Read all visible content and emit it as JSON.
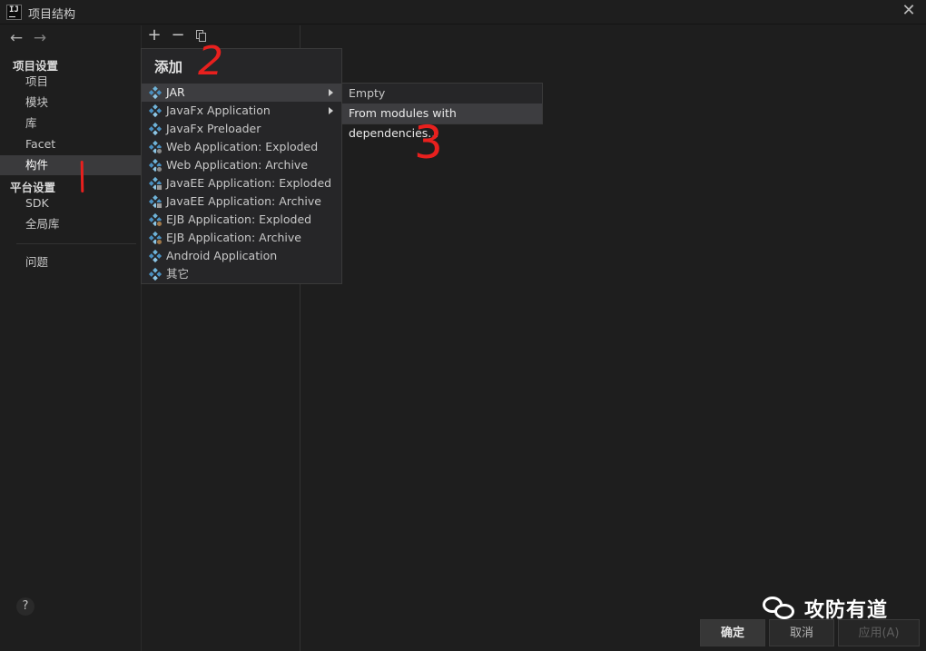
{
  "window": {
    "app_icon_text": "IJ",
    "title": "项目结构",
    "close_glyph": "✕"
  },
  "nav": {
    "back_glyph": "←",
    "forward_glyph": "→"
  },
  "sidebar": {
    "project_settings_header": "项目设置",
    "project_items": [
      {
        "label": "项目"
      },
      {
        "label": "模块"
      },
      {
        "label": "库"
      },
      {
        "label": "Facet"
      },
      {
        "label": "构件",
        "selected": true
      }
    ],
    "platform_settings_header": "平台设置",
    "platform_items": [
      {
        "label": "SDK"
      },
      {
        "label": "全局库"
      }
    ],
    "problems_label": "问题",
    "help_label": "?"
  },
  "toolbar": {
    "add_glyph": "+",
    "remove_glyph": "−",
    "copy_icon": "copy-icon"
  },
  "popup": {
    "title": "添加",
    "items": [
      {
        "label": "JAR",
        "has_submenu": true,
        "active": true
      },
      {
        "label": "JavaFx Application",
        "has_submenu": true
      },
      {
        "label": "JavaFx Preloader"
      },
      {
        "label": "Web Application: Exploded"
      },
      {
        "label": "Web Application: Archive"
      },
      {
        "label": "JavaEE Application: Exploded"
      },
      {
        "label": "JavaEE Application: Archive"
      },
      {
        "label": "EJB Application: Exploded"
      },
      {
        "label": "EJB Application: Archive"
      },
      {
        "label": "Android Application"
      },
      {
        "label": "其它"
      }
    ]
  },
  "submenu": {
    "items": [
      {
        "label": "Empty"
      },
      {
        "label": "From modules with dependencies...",
        "active": true
      }
    ]
  },
  "annotations": {
    "step_2": "2",
    "step_3": "3"
  },
  "watermark": {
    "text": "攻防有道"
  },
  "buttons": {
    "ok": "确定",
    "cancel": "取消",
    "apply": "应用(A)"
  },
  "colors": {
    "background": "#1e1e1e",
    "selection": "#3a3a3c",
    "annotation": "#e8201e",
    "artifact_icon": "#4a90c0"
  }
}
